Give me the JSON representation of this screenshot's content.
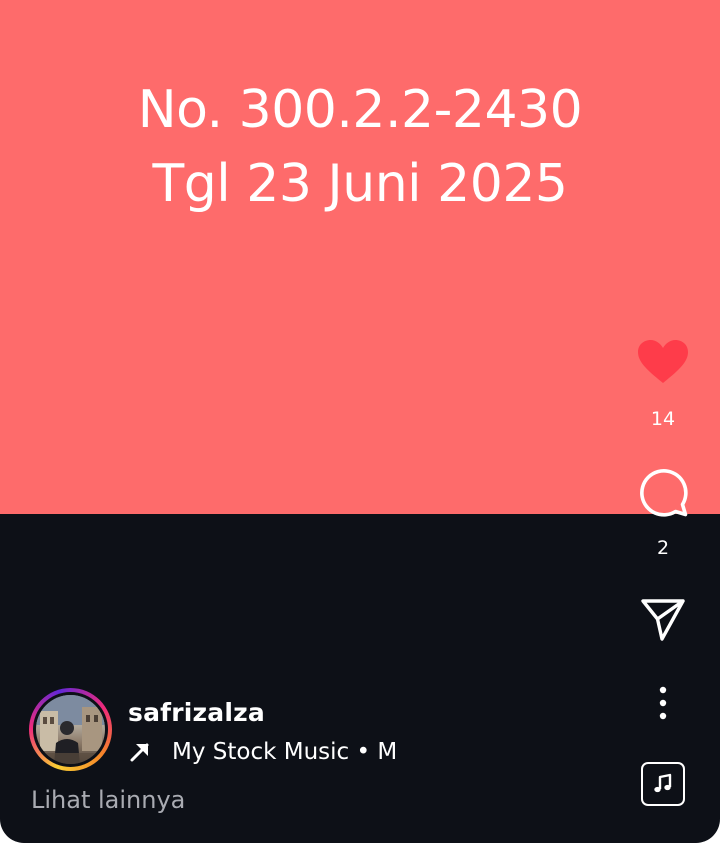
{
  "post": {
    "text_line1": "No. 300.2.2-2430",
    "text_line2": "Tgl 23 Juni 2025",
    "background_color": "#fe6b6b"
  },
  "actions": {
    "like_icon": "heart-filled-icon",
    "like_color": "#fe3c4a",
    "like_count": "14",
    "comment_icon": "comment-icon",
    "comment_count": "2",
    "share_icon": "send-icon",
    "more_icon": "more-vertical-icon",
    "music_icon": "music-note-icon"
  },
  "author": {
    "username": "safrizalza",
    "avatar_icon": "avatar"
  },
  "audio": {
    "arrow_icon": "arrow-up-right-icon",
    "label": "My Stock Music • M"
  },
  "caption": {
    "see_more": "Lihat lainnya"
  }
}
